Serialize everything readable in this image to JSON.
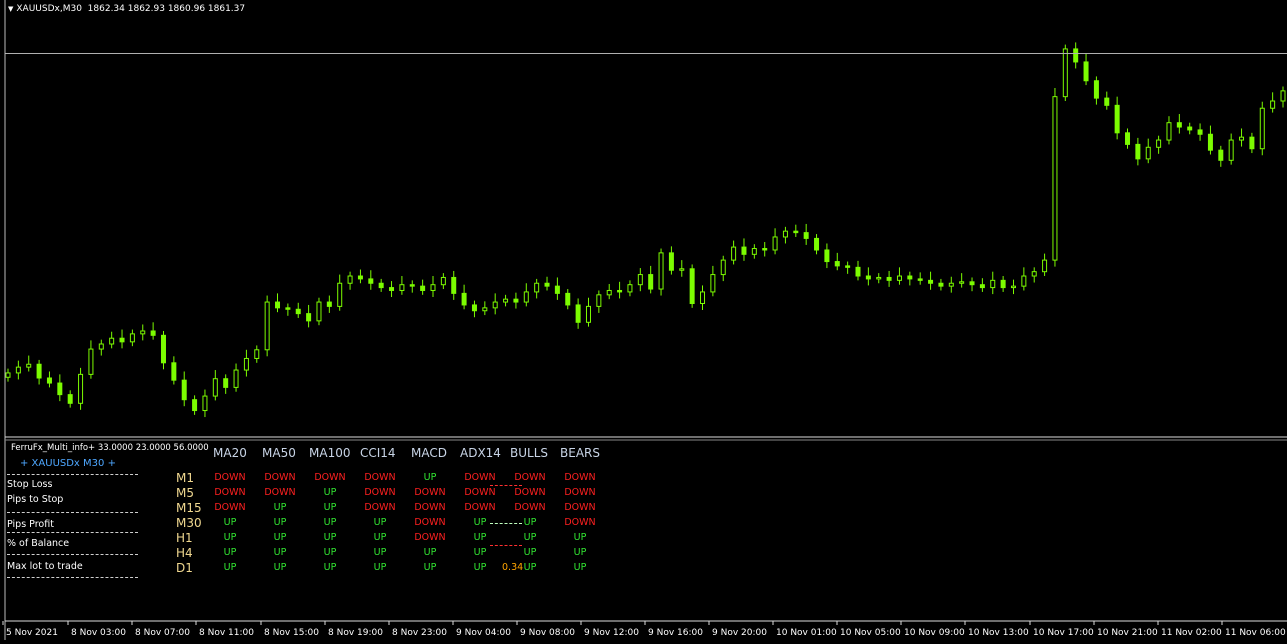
{
  "header": {
    "symbol_tf": "XAUUSDx,M30",
    "ohlc": "1862.34 1862.93 1860.96 1861.37"
  },
  "indicator": {
    "title": "FerruFx_Multi_info+ 33.0000 23.0000 56.0000",
    "symbol_line": "+  XAUUSDx  M30  +",
    "labels": {
      "stop_loss": "Stop Loss",
      "pips_to_stop": "Pips to Stop",
      "pips_profit": "Pips Profit",
      "pct_balance": "% of Balance",
      "max_lot": "Max lot to trade"
    },
    "max_lot_value": "0.34",
    "columns": [
      "MA20",
      "MA50",
      "MA100",
      "CCI14",
      "MACD",
      "ADX14",
      "BULLS",
      "BEARS"
    ],
    "rows": [
      {
        "tf": "M1",
        "values": [
          "DOWN",
          "DOWN",
          "DOWN",
          "DOWN",
          "UP",
          "DOWN",
          "DOWN",
          "DOWN"
        ]
      },
      {
        "tf": "M5",
        "values": [
          "DOWN",
          "DOWN",
          "UP",
          "DOWN",
          "DOWN",
          "DOWN",
          "DOWN",
          "DOWN"
        ]
      },
      {
        "tf": "M15",
        "values": [
          "DOWN",
          "UP",
          "UP",
          "DOWN",
          "DOWN",
          "DOWN",
          "DOWN",
          "DOWN"
        ]
      },
      {
        "tf": "M30",
        "values": [
          "UP",
          "UP",
          "UP",
          "UP",
          "DOWN",
          "UP",
          "UP",
          "DOWN"
        ]
      },
      {
        "tf": "H1",
        "values": [
          "UP",
          "UP",
          "UP",
          "UP",
          "DOWN",
          "UP",
          "UP",
          "UP"
        ]
      },
      {
        "tf": "H4",
        "values": [
          "UP",
          "UP",
          "UP",
          "UP",
          "UP",
          "UP",
          "UP",
          "UP"
        ]
      },
      {
        "tf": "D1",
        "values": [
          "UP",
          "UP",
          "UP",
          "UP",
          "UP",
          "UP",
          "UP",
          "UP"
        ]
      }
    ]
  },
  "colors": {
    "up": "#32e532",
    "down": "#ff2020",
    "candle": "#7cfc00",
    "bid_line": "#b0b0b0"
  },
  "chart_data": {
    "type": "candlestick",
    "symbol": "XAUUSDx",
    "timeframe": "M30",
    "x_tick_labels": [
      "5 Nov 2021",
      "8 Nov 03:00",
      "8 Nov 07:00",
      "8 Nov 11:00",
      "8 Nov 15:00",
      "8 Nov 19:00",
      "8 Nov 23:00",
      "9 Nov 04:00",
      "9 Nov 08:00",
      "9 Nov 12:00",
      "9 Nov 16:00",
      "9 Nov 20:00",
      "10 Nov 01:00",
      "10 Nov 05:00",
      "10 Nov 09:00",
      "10 Nov 13:00",
      "10 Nov 17:00",
      "10 Nov 21:00",
      "11 Nov 02:00",
      "11 Nov 06:00"
    ],
    "bid": 1861.37,
    "closes": [
      1817.2,
      1818.0,
      1818.4,
      1816.5,
      1815.8,
      1814.2,
      1813.0,
      1817.0,
      1820.5,
      1821.2,
      1822.0,
      1821.5,
      1822.6,
      1823.0,
      1822.4,
      1818.6,
      1816.2,
      1813.5,
      1812.0,
      1814.0,
      1816.4,
      1815.2,
      1817.6,
      1819.2,
      1820.4,
      1827.0,
      1826.2,
      1826.0,
      1825.4,
      1824.4,
      1827.0,
      1826.4,
      1829.6,
      1830.6,
      1830.2,
      1829.6,
      1829.0,
      1828.6,
      1829.4,
      1829.2,
      1828.6,
      1829.4,
      1830.4,
      1828.2,
      1826.6,
      1825.8,
      1826.2,
      1827.0,
      1827.4,
      1827.0,
      1828.4,
      1829.6,
      1829.2,
      1828.2,
      1826.6,
      1824.2,
      1826.4,
      1828.0,
      1828.6,
      1828.4,
      1829.4,
      1830.8,
      1828.8,
      1833.8,
      1831.4,
      1831.6,
      1826.8,
      1828.4,
      1830.8,
      1832.8,
      1834.6,
      1833.6,
      1834.4,
      1834.2,
      1836.0,
      1836.8,
      1836.6,
      1835.8,
      1834.2,
      1832.6,
      1832.0,
      1831.8,
      1830.6,
      1830.2,
      1830.4,
      1830.0,
      1830.6,
      1830.2,
      1830.0,
      1829.6,
      1829.2,
      1829.6,
      1829.8,
      1829.4,
      1829.0,
      1830.0,
      1829.0,
      1829.2,
      1830.6,
      1831.2,
      1832.8,
      1855.4,
      1862.0,
      1860.2,
      1857.6,
      1855.2,
      1854.2,
      1850.4,
      1848.8,
      1846.8,
      1848.4,
      1849.4,
      1851.8,
      1851.2,
      1850.8,
      1850.2,
      1848.0,
      1846.6,
      1849.4,
      1849.8,
      1848.2,
      1853.8,
      1854.8,
      1856.2
    ]
  }
}
